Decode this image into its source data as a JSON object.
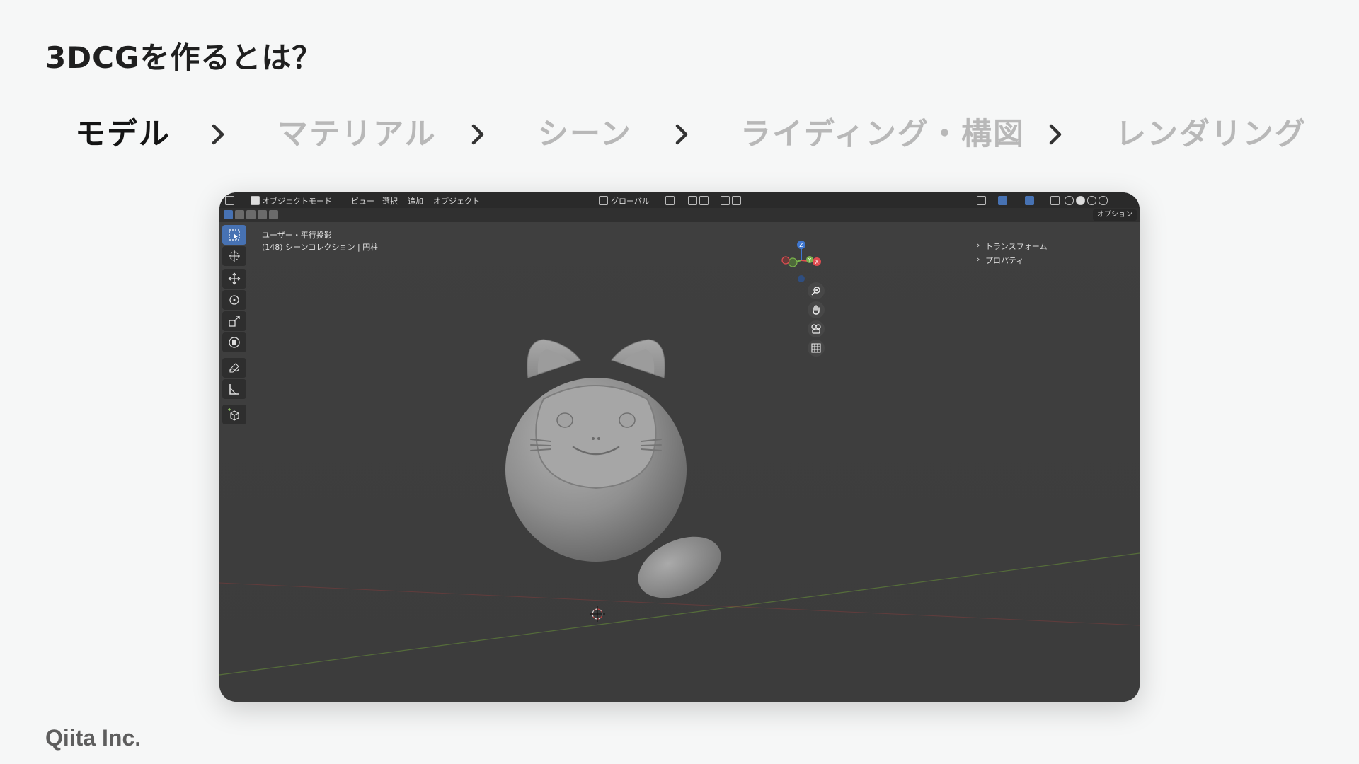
{
  "slide": {
    "title": "3DCGを作るとは？",
    "footer": "Qiita Inc."
  },
  "steps": [
    {
      "label": "モデル",
      "active": true
    },
    {
      "label": "マテリアル",
      "active": false
    },
    {
      "label": "シーン",
      "active": false
    },
    {
      "label": "ライディング・構図",
      "active": false
    },
    {
      "label": "レンダリング",
      "active": false
    }
  ],
  "blender": {
    "header": {
      "mode": "オブジェクトモード",
      "menus": [
        "ビュー",
        "選択",
        "追加",
        "オブジェクト"
      ],
      "transform_orientation": "グローバル"
    },
    "options_label": "オプション",
    "viewport": {
      "view_name": "ユーザー・平行投影",
      "collection": "(148) シーンコレクション | 円柱"
    },
    "side_panel": {
      "transform": "トランスフォーム",
      "properties": "プロパティ"
    },
    "gizmo_axes": {
      "x": "X",
      "y": "Y",
      "z": "Z"
    },
    "colors": {
      "accent": "#4772b3",
      "axis_x": "#e04c50",
      "axis_y": "#7bb34c",
      "axis_z": "#3f77d0"
    }
  }
}
